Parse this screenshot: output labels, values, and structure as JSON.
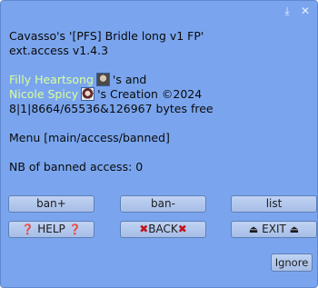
{
  "header": {
    "pin_icon": "download-arrow-icon",
    "close_icon": "close-icon"
  },
  "info": {
    "title": "Cavasso's '[PFS] Bridle long v1 FP'",
    "version": "ext.access v1.4.3",
    "creator1": "Filly Heartsong",
    "creator1_suffix": "'s and",
    "creator2": "Nicole Spicy",
    "creator2_suffix": "'s Creation ©2024",
    "memory": "8|1|8664/65536&126967 bytes free",
    "menu": "Menu [main/access/banned]",
    "banned_count": "NB of banned access: 0"
  },
  "buttons": {
    "ban_plus": "ban+",
    "ban_minus": "ban-",
    "list": "list",
    "help": "HELP",
    "back": "BACK",
    "exit": "EXIT",
    "ignore": "Ignore"
  },
  "colors": {
    "dialog_bg": "#7aa5ee",
    "link": "#d9ff9a",
    "button_bg": "#b3c8ec"
  }
}
